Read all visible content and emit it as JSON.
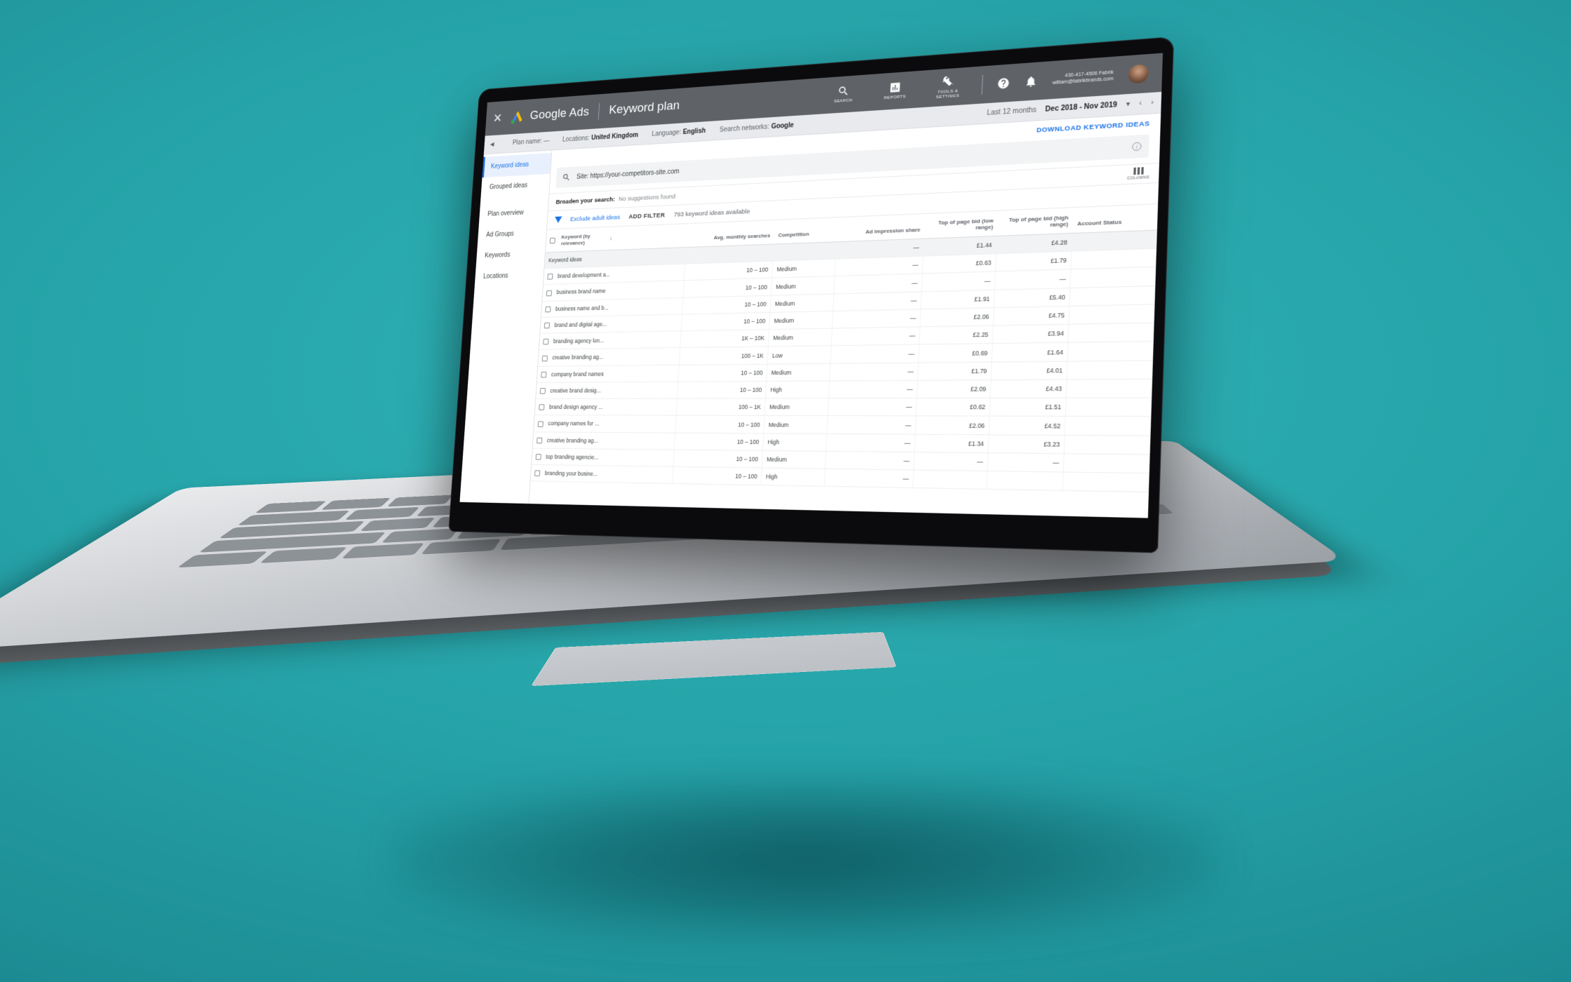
{
  "theme": {
    "background_teal": "#25a3a8",
    "accent_blue": "#1a73e8",
    "topbar_gray": "#5f6368"
  },
  "app": {
    "close_label": "✕",
    "brand": "Google Ads",
    "page_title": "Keyword plan",
    "icons": [
      {
        "name": "search-icon",
        "label": "SEARCH"
      },
      {
        "name": "reports-icon",
        "label": "REPORTS"
      },
      {
        "name": "tools-settings-icon",
        "label": "TOOLS & SETTINGS"
      }
    ],
    "help_label": "?",
    "account": {
      "line1": "430-417-4506 Fabrik",
      "line2": "william@fabrikbrands.com"
    }
  },
  "filterbar": {
    "back_caret": "◀",
    "plan_name": "Plan name: —",
    "locations_label": "Locations:",
    "locations_value": "United Kingdom",
    "language_label": "Language:",
    "language_value": "English",
    "networks_label": "Search networks:",
    "networks_value": "Google",
    "date_label": "Last 12 months",
    "date_value": "Dec 2018 - Nov 2019",
    "date_caret": "▾",
    "prev": "‹",
    "next": "›"
  },
  "sidebar": {
    "items": [
      {
        "label": "Keyword ideas",
        "active": true
      },
      {
        "label": "Grouped ideas",
        "active": false
      },
      {
        "label": "Plan overview",
        "active": false
      },
      {
        "label": "Ad Groups",
        "active": false
      },
      {
        "label": "Keywords",
        "active": false
      },
      {
        "label": "Locations",
        "active": false
      }
    ]
  },
  "main": {
    "download_link": "DOWNLOAD KEYWORD IDEAS",
    "search": {
      "value": "Site: https://your-competitors-site.com",
      "info_glyph": "i"
    },
    "broaden": {
      "label": "Broaden your search:",
      "value": "No suggestions found"
    },
    "columns_button": "COLUMNS",
    "filters": {
      "exclude_adult": "Exclude adult ideas",
      "add_filter": "ADD FILTER",
      "count": "793 keyword ideas available"
    },
    "table": {
      "columns": [
        "Keyword (by relevance)",
        "Avg. monthly searches",
        "Competition",
        "Ad impression share",
        "Top of page bid (low range)",
        "Top of page bid (high range)",
        "Account Status"
      ],
      "group_row": {
        "label": "Keyword ideas",
        "searches": "",
        "competition": "",
        "impression_share": "—",
        "bid_low": "£1.44",
        "bid_high": "£4.28",
        "account_status": ""
      },
      "rows": [
        {
          "keyword": "brand development a...",
          "searches": "10 – 100",
          "competition": "Medium",
          "impression_share": "—",
          "bid_low": "£0.63",
          "bid_high": "£1.79",
          "account_status": ""
        },
        {
          "keyword": "business brand name",
          "searches": "10 – 100",
          "competition": "Medium",
          "impression_share": "—",
          "bid_low": "—",
          "bid_high": "—",
          "account_status": ""
        },
        {
          "keyword": "business name and b...",
          "searches": "10 – 100",
          "competition": "Medium",
          "impression_share": "—",
          "bid_low": "£1.91",
          "bid_high": "£5.40",
          "account_status": ""
        },
        {
          "keyword": "brand and digital age...",
          "searches": "10 – 100",
          "competition": "Medium",
          "impression_share": "—",
          "bid_low": "£2.06",
          "bid_high": "£4.75",
          "account_status": ""
        },
        {
          "keyword": "branding agency lon...",
          "searches": "1K – 10K",
          "competition": "Medium",
          "impression_share": "—",
          "bid_low": "£2.25",
          "bid_high": "£3.94",
          "account_status": ""
        },
        {
          "keyword": "creative branding ag...",
          "searches": "100 – 1K",
          "competition": "Low",
          "impression_share": "—",
          "bid_low": "£0.69",
          "bid_high": "£1.64",
          "account_status": ""
        },
        {
          "keyword": "company brand names",
          "searches": "10 – 100",
          "competition": "Medium",
          "impression_share": "—",
          "bid_low": "£1.79",
          "bid_high": "£4.01",
          "account_status": ""
        },
        {
          "keyword": "creative brand desig...",
          "searches": "10 – 100",
          "competition": "High",
          "impression_share": "—",
          "bid_low": "£2.09",
          "bid_high": "£4.43",
          "account_status": ""
        },
        {
          "keyword": "brand design agency ...",
          "searches": "100 – 1K",
          "competition": "Medium",
          "impression_share": "—",
          "bid_low": "£0.62",
          "bid_high": "£1.51",
          "account_status": ""
        },
        {
          "keyword": "company names for ...",
          "searches": "10 – 100",
          "competition": "Medium",
          "impression_share": "—",
          "bid_low": "£2.06",
          "bid_high": "£4.52",
          "account_status": ""
        },
        {
          "keyword": "creative branding ag...",
          "searches": "10 – 100",
          "competition": "High",
          "impression_share": "—",
          "bid_low": "£1.34",
          "bid_high": "£3.23",
          "account_status": ""
        },
        {
          "keyword": "top branding agencie...",
          "searches": "10 – 100",
          "competition": "Medium",
          "impression_share": "—",
          "bid_low": "—",
          "bid_high": "—",
          "account_status": ""
        },
        {
          "keyword": "branding your busine...",
          "searches": "10 – 100",
          "competition": "High",
          "impression_share": "—",
          "bid_low": "",
          "bid_high": "",
          "account_status": ""
        }
      ]
    }
  }
}
